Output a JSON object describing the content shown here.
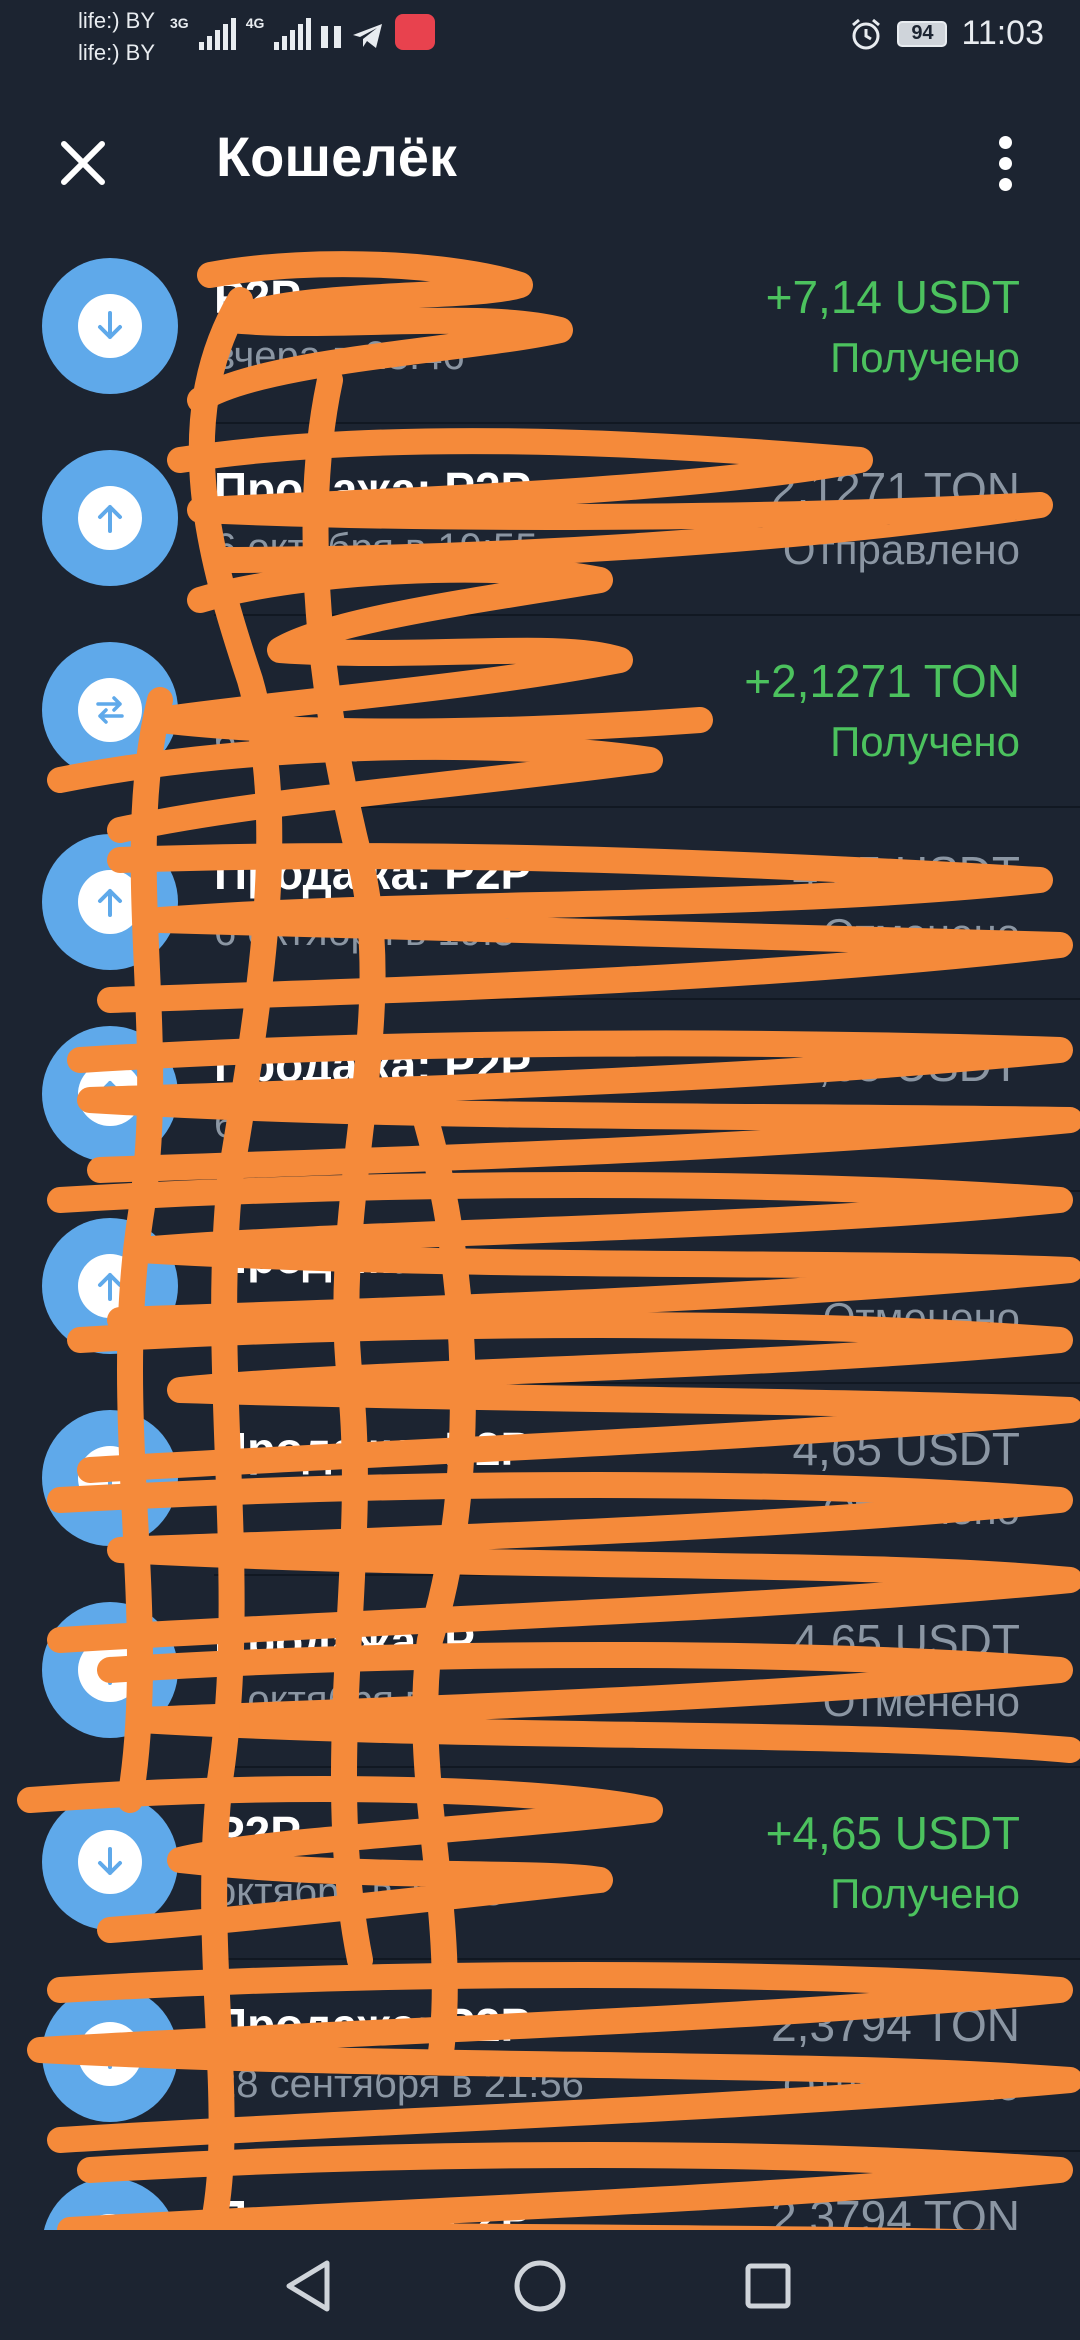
{
  "status_bar": {
    "carrier_1": "life:) BY",
    "carrier_2": "life:) BY",
    "net_1": "3G",
    "net_2": "4G",
    "battery": "94",
    "time": "11:03",
    "icons": [
      "signal-icon",
      "signal-icon",
      "pause-icon",
      "telegram-icon",
      "app-badge-icon",
      "alarm-icon",
      "battery-icon"
    ]
  },
  "header": {
    "title": "Кошелёк",
    "close_icon": "close-icon",
    "more_icon": "more-vertical-icon"
  },
  "transactions": [
    {
      "title": "P2P",
      "subtitle": "вчера в 23:46",
      "amount": "+7,14 USDT",
      "status": "Получено",
      "direction": "in",
      "icon": "arrow-down-icon"
    },
    {
      "title": "Продажа: P2P",
      "subtitle": "6 октября в 19:55",
      "amount": "2,1271 TON",
      "status": "Отправлено",
      "direction": "out",
      "icon": "arrow-up-icon"
    },
    {
      "title": "",
      "subtitle": "6 октября в 19:54",
      "amount": "+2,1271 TON",
      "status": "Получено",
      "direction": "in",
      "icon": "swap-icon"
    },
    {
      "title": "Продажа: P2P",
      "subtitle": "6 октября в 19:5",
      "amount": "4,65 USDT",
      "status": "Отменено",
      "direction": "out",
      "icon": "arrow-up-icon"
    },
    {
      "title": "Продажа: P2P",
      "subtitle": "6",
      "amount": "4,65 USDT",
      "status": "",
      "direction": "out",
      "icon": "arrow-up-icon"
    },
    {
      "title": "Продажа",
      "subtitle": "6 октября в",
      "amount": "",
      "status": "Отменено",
      "direction": "out",
      "icon": "arrow-up-icon"
    },
    {
      "title": "Продажа: P2P",
      "subtitle": "",
      "amount": "4,65 USDT",
      "status": "Отменено",
      "direction": "out",
      "icon": "arrow-up-icon"
    },
    {
      "title": "Продажа: P",
      "subtitle": "6 октября в",
      "amount": "4,65 USDT",
      "status": "Отменено",
      "direction": "out",
      "icon": "arrow-up-icon"
    },
    {
      "title": "P2P",
      "subtitle": "октября в 19:43",
      "amount": "+4,65 USDT",
      "status": "Получено",
      "direction": "in",
      "icon": "arrow-down-icon"
    },
    {
      "title": "Продажа: P2P",
      "subtitle": "28 сентября в 21:56",
      "amount": "2,3794 TON",
      "status": "Отправлено",
      "direction": "out",
      "icon": "arrow-up-icon"
    },
    {
      "title": "Продажа: P2P",
      "subtitle": "",
      "amount": "2,3794 TON",
      "status": "",
      "direction": "out",
      "icon": "arrow-up-icon"
    }
  ],
  "colors": {
    "background": "#1c2431",
    "icon_circle": "#5fa9ea",
    "positive": "#4cc25e",
    "muted": "#8b96a3",
    "scribble": "#f58a3a"
  },
  "nav_bar": {
    "back_icon": "back-triangle-icon",
    "home_icon": "home-circle-icon",
    "recents_icon": "recents-square-icon"
  }
}
